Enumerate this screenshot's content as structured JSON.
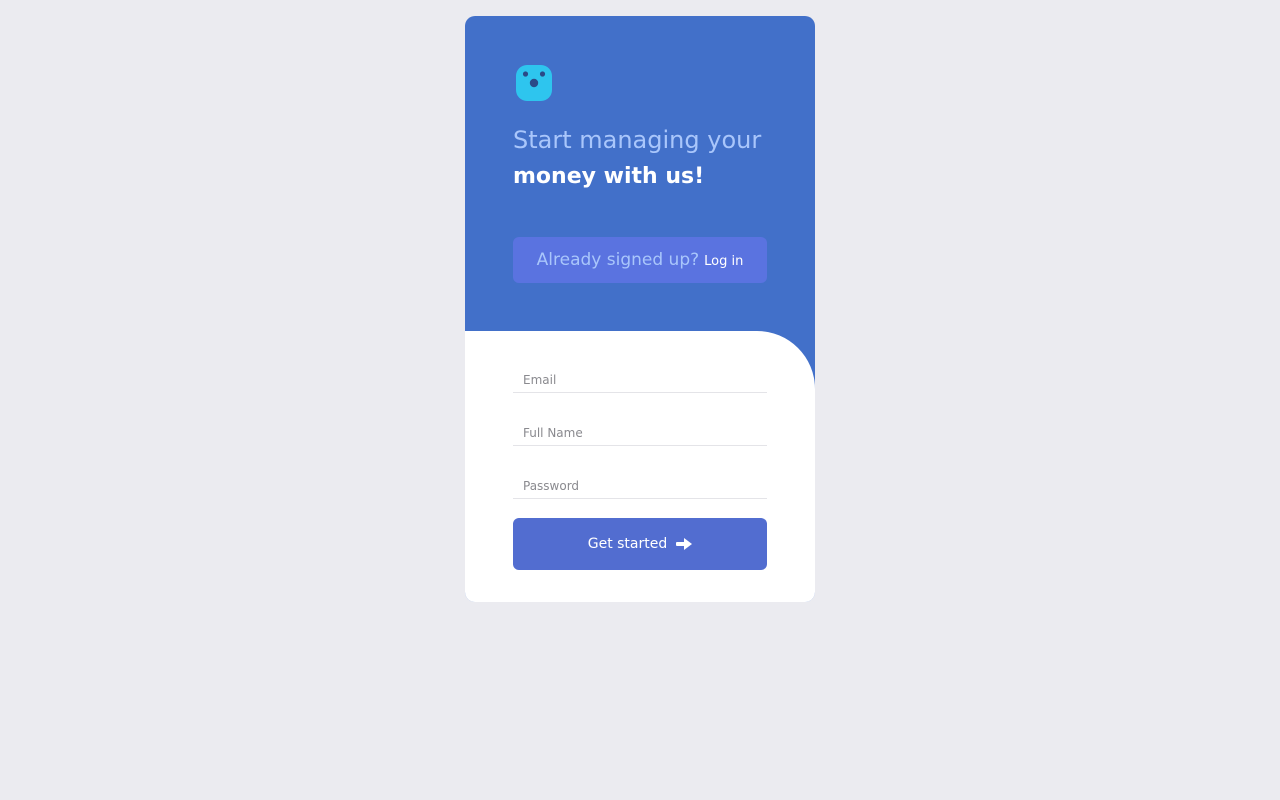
{
  "header": {
    "headline_light": "Start managing your",
    "headline_bold": "money with us!",
    "signed_up_text": "Already signed up?",
    "login_label": "Log in"
  },
  "form": {
    "email_placeholder": "Email",
    "fullname_placeholder": "Full Name",
    "password_placeholder": "Password",
    "submit_label": "Get started"
  },
  "icons": {
    "logo": "face-logo-icon",
    "submit": "arrow-right-icon"
  },
  "colors": {
    "page_background": "#ebebf0",
    "card_background": "#4270c9",
    "accent_button": "#526dd0",
    "signed_box": "#5a73e0",
    "logo": "#2ec5ee",
    "headline_light": "#a9c6fb"
  }
}
